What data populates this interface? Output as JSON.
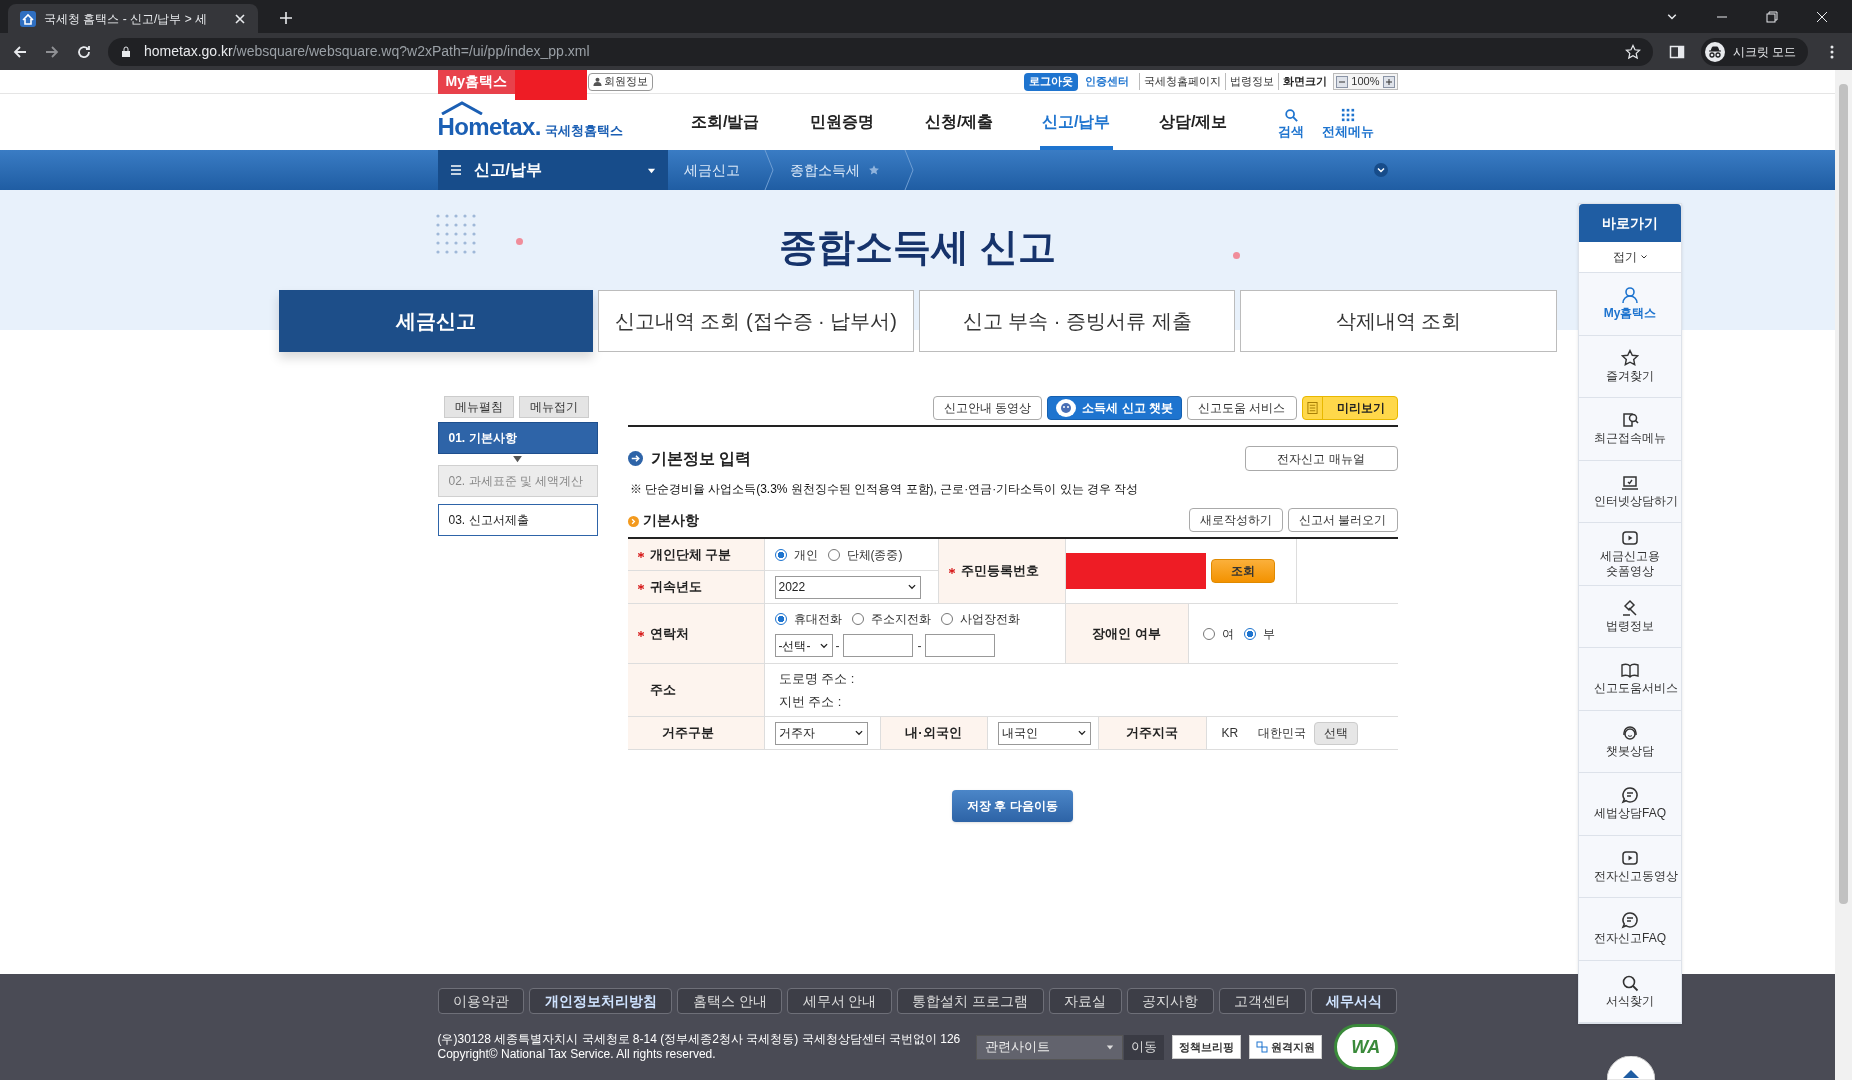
{
  "browser": {
    "tab_title": "국세청 홈택스 - 신고/납부 > 세",
    "url_host": "hometax.go.kr",
    "url_path": "/websquare/websquare.wq?w2xPath=/ui/pp/index_pp.xml",
    "profile": "시크릿 모드"
  },
  "utility_bar": {
    "my_label": "My홈택스",
    "member_button": "회원정보",
    "links": [
      {
        "label": "로그아웃",
        "kind": "button"
      },
      {
        "label": "인증센터",
        "kind": "accent"
      },
      {
        "label": "국세청홈페이지",
        "kind": "plain"
      },
      {
        "label": "법령정보",
        "kind": "plain"
      },
      {
        "label": "화면크기",
        "kind": "bold"
      }
    ],
    "zoom": "100%"
  },
  "header": {
    "logo": "Hometax.",
    "logo_sub": "국세청홈택스",
    "nav": [
      {
        "label": "조회/발급",
        "selected": false
      },
      {
        "label": "민원증명",
        "selected": false
      },
      {
        "label": "신청/제출",
        "selected": false
      },
      {
        "label": "신고/납부",
        "selected": true
      },
      {
        "label": "상담/제보",
        "selected": false
      }
    ],
    "tools": [
      "검색",
      "전체메뉴"
    ]
  },
  "breadcrumb": {
    "menu": "신고/납부",
    "items": [
      "세금신고",
      "종합소득세"
    ]
  },
  "banner": {
    "title": "종합소득세 신고"
  },
  "tabs": [
    {
      "label": "세금신고",
      "selected": true
    },
    {
      "label": "신고내역 조회 (접수증 · 납부서)",
      "selected": false
    },
    {
      "label": "신고 부속 · 증빙서류 제출",
      "selected": false
    },
    {
      "label": "삭제내역 조회",
      "selected": false
    }
  ],
  "left_menu": {
    "buttons": [
      "메뉴펼침",
      "메뉴접기"
    ],
    "steps": [
      {
        "label": "01. 기본사항",
        "selected": true,
        "disabled": false
      },
      {
        "label": "02. 과세표준 및 세액계산",
        "selected": false,
        "disabled": true
      },
      {
        "label": "03. 신고서제출",
        "selected": false,
        "disabled": false
      }
    ]
  },
  "toolbar": [
    {
      "label": "신고안내 동영상",
      "kind": "plain"
    },
    {
      "label": "소득세 신고 챗봇",
      "kind": "chatbot"
    },
    {
      "label": "신고도움 서비스",
      "kind": "plain"
    },
    {
      "label": "미리보기",
      "kind": "preview"
    }
  ],
  "section": {
    "title": "기본정보 입력",
    "manual_button": "전자신고 매뉴얼",
    "notice": "※ 단순경비율 사업소득(3.3% 원천징수된 인적용역 포함), 근로·연금·기타소득이 있는 경우 작성",
    "subtitle": "기본사항",
    "buttons": [
      "새로작성하기",
      "신고서 불러오기"
    ]
  },
  "form": {
    "entity_type": {
      "label": "개인단체 구분",
      "required": true,
      "options": [
        {
          "label": "개인",
          "selected": true
        },
        {
          "label": "단체(종중)",
          "selected": false
        }
      ]
    },
    "year": {
      "label": "귀속년도",
      "required": true,
      "value": "2022"
    },
    "resident_no": {
      "label": "주민등록번호",
      "required": true,
      "button": "조회"
    },
    "contact": {
      "label": "연락처",
      "required": true,
      "options": [
        {
          "label": "휴대전화",
          "selected": true
        },
        {
          "label": "주소지전화",
          "selected": false
        },
        {
          "label": "사업장전화",
          "selected": false
        }
      ],
      "area_code": "-선택-",
      "separators": [
        "-",
        "-"
      ]
    },
    "disability": {
      "label": "장애인 여부",
      "required": false,
      "options": [
        {
          "label": "여",
          "selected": false
        },
        {
          "label": "부",
          "selected": true
        }
      ]
    },
    "address": {
      "label": "주소",
      "required": false,
      "lines": [
        "도로명 주소 :",
        "지번 주소 :"
      ]
    },
    "residence": {
      "label": "거주구분",
      "value": "거주자"
    },
    "nationality": {
      "label": "내·외국인",
      "value": "내국인"
    },
    "country": {
      "label": "거주지국",
      "code": "KR",
      "name": "대한민국",
      "button": "선택"
    }
  },
  "submit": "저장 후 다음이동",
  "quick_menu": {
    "title": "바로가기",
    "toggle": "접기",
    "items": [
      {
        "label": "My홈택스",
        "selected": true
      },
      {
        "label": "즐겨찾기",
        "selected": false
      },
      {
        "label": "최근접속메뉴",
        "selected": false
      },
      {
        "label": "인터넷상담하기",
        "selected": false
      },
      {
        "label": "세금신고용 숏폼영상",
        "selected": false
      },
      {
        "label": "법령정보",
        "selected": false
      },
      {
        "label": "신고도움서비스",
        "selected": false
      },
      {
        "label": "챗봇상담",
        "selected": false
      },
      {
        "label": "세법상담FAQ",
        "selected": false
      },
      {
        "label": "전자신고동영상",
        "selected": false
      },
      {
        "label": "전자신고FAQ",
        "selected": false
      },
      {
        "label": "서식찾기",
        "selected": false
      }
    ]
  },
  "footer": {
    "links": [
      {
        "label": "이용약관",
        "highlighted": false
      },
      {
        "label": "개인정보처리방침",
        "highlighted": true
      },
      {
        "label": "홈택스 안내",
        "highlighted": false
      },
      {
        "label": "세무서 안내",
        "highlighted": false
      },
      {
        "label": "통합설치 프로그램",
        "highlighted": false
      },
      {
        "label": "자료실",
        "highlighted": false
      },
      {
        "label": "공지사항",
        "highlighted": false
      },
      {
        "label": "고객센터",
        "highlighted": false
      },
      {
        "label": "세무서식",
        "highlighted": true
      }
    ],
    "address": "(우)30128 세종특별자치시 국세청로 8-14 (정부세종2청사 국세청동) 국세청상담센터 국번없이 126",
    "copyright": "Copyright© National Tax Service. All rights reserved.",
    "site_select": "관련사이트",
    "go_button": "이동",
    "buttons": [
      "정책브리핑",
      "원격지원"
    ],
    "badge": "WA"
  }
}
